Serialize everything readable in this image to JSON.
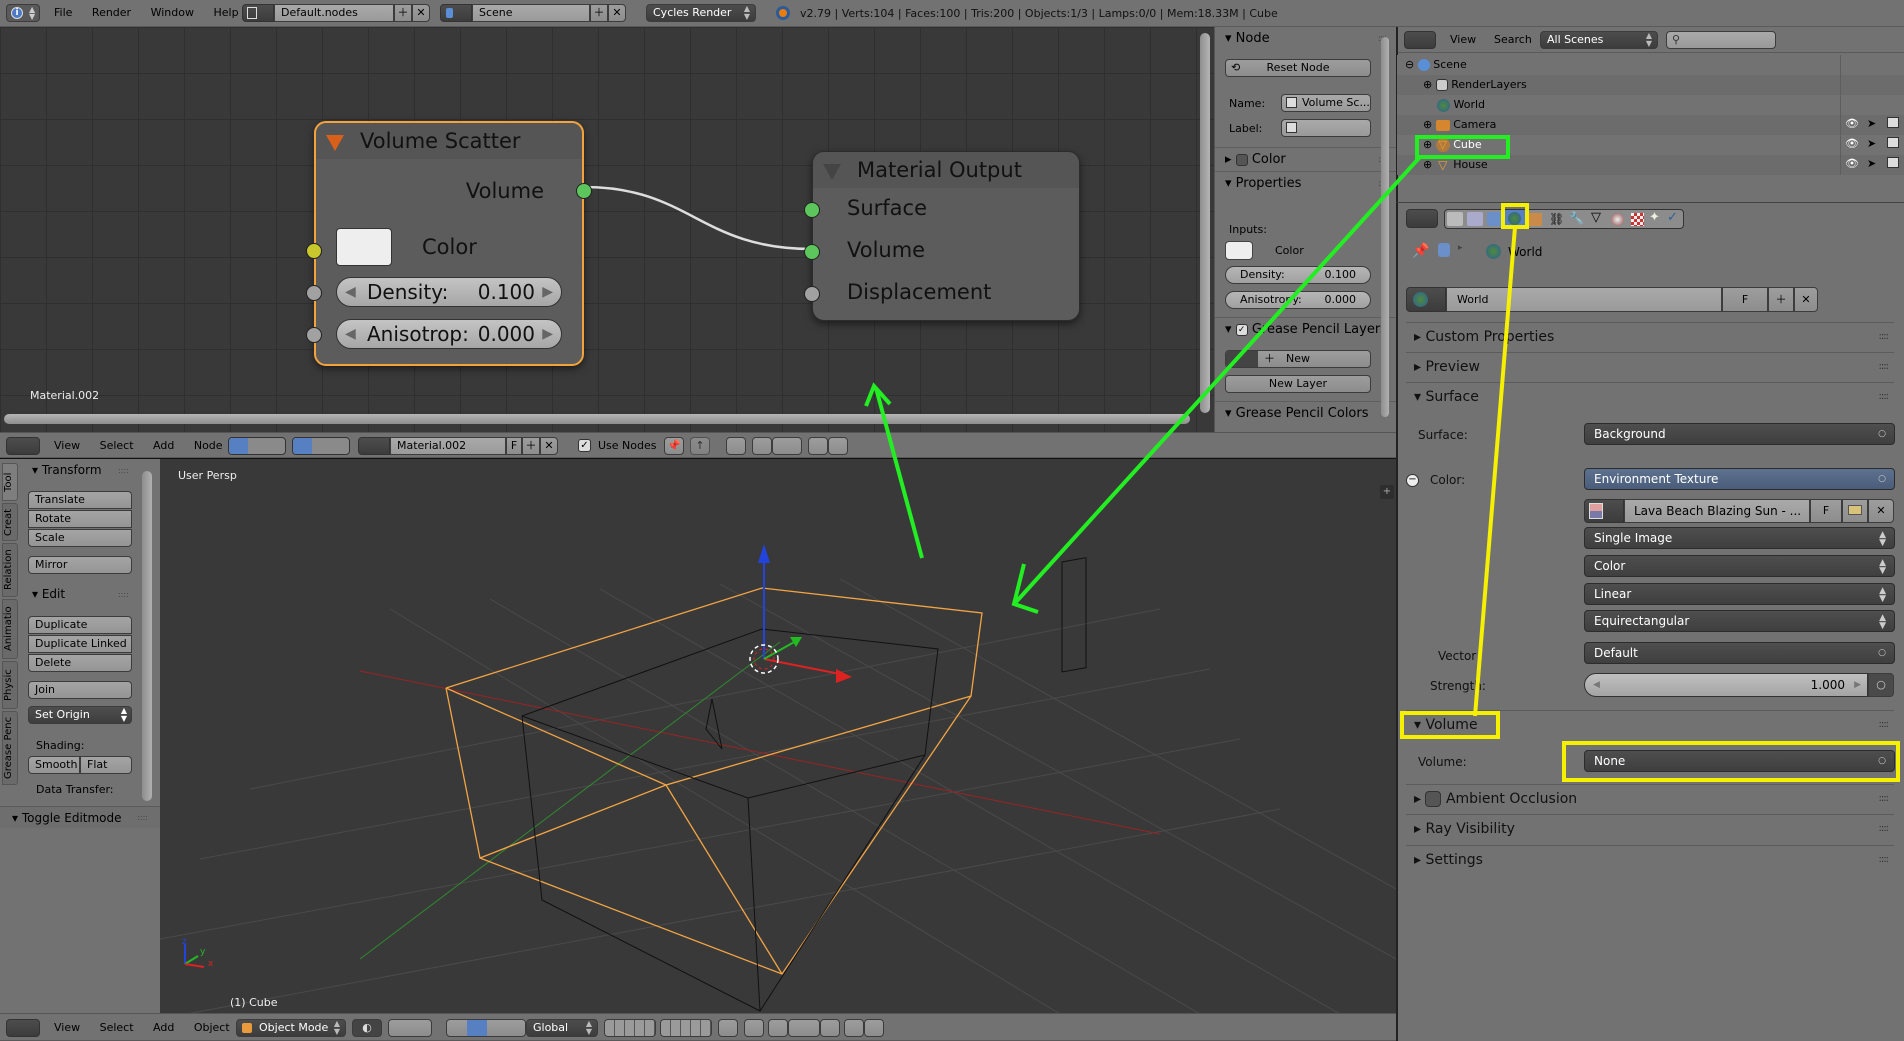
{
  "topbar": {
    "menus": [
      "File",
      "Render",
      "Window",
      "Help"
    ],
    "screen_layout": "Default.nodes",
    "scene": "Scene",
    "render_engine": "Cycles Render",
    "stats": "v2.79 | Verts:104 | Faces:100 | Tris:200 | Objects:1/3 | Lamps:0/0 | Mem:18.33M | Cube"
  },
  "node_editor": {
    "material_label": "Material.002",
    "nodes": {
      "volume_scatter": {
        "title": "Volume Scatter",
        "output": "Volume",
        "color_label": "Color",
        "density_label": "Density:",
        "density_value": "0.100",
        "anisotropy_label": "Anisotrop:",
        "anisotropy_value": "0.000"
      },
      "material_output": {
        "title": "Material Output",
        "inputs": [
          "Surface",
          "Volume",
          "Displacement"
        ]
      }
    },
    "header": {
      "menus": [
        "View",
        "Select",
        "Add",
        "Node"
      ],
      "material": "Material.002",
      "fake_user": "F",
      "use_nodes_label": "Use Nodes",
      "use_nodes": true
    },
    "sidebar": {
      "node_panel": "Node",
      "reset_node": "Reset Node",
      "name_label": "Name:",
      "name_value": "Volume Sc...",
      "label_label": "Label:",
      "label_value": "",
      "color_panel": "Color",
      "properties_panel": "Properties",
      "inputs_label": "Inputs:",
      "color_label": "Color",
      "density_label": "Density:",
      "density_value": "0.100",
      "anisotropy_label": "Anisotropy:",
      "anisotropy_value": "0.000",
      "grease_layers_panel": "Grease Pencil Layers",
      "new_button": "New",
      "new_layer_button": "New Layer",
      "grease_colors_panel": "Grease Pencil Colors"
    }
  },
  "viewport": {
    "view_name": "User Persp",
    "object_label": "(1) Cube",
    "tool_tabs": [
      "Tool",
      "Creat",
      "Relation",
      "Animatio",
      "Physic",
      "Grease Penc"
    ],
    "transform_panel": "Transform",
    "transform_buttons": [
      "Translate",
      "Rotate",
      "Scale"
    ],
    "mirror": "Mirror",
    "edit_panel": "Edit",
    "edit_buttons": [
      "Duplicate",
      "Duplicate Linked",
      "Delete"
    ],
    "join": "Join",
    "set_origin": "Set Origin",
    "shading_label": "Shading:",
    "smooth": "Smooth",
    "flat": "Flat",
    "data_transfer_label": "Data Transfer:",
    "toggle_editmode": "Toggle Editmode",
    "axis_labels": [
      "x",
      "y",
      "z"
    ],
    "header": {
      "menus": [
        "View",
        "Select",
        "Add",
        "Object"
      ],
      "mode": "Object Mode",
      "orientation": "Global"
    }
  },
  "outliner": {
    "menus": [
      "View",
      "Search"
    ],
    "filter": "All Scenes",
    "search_placeholder": "",
    "items": [
      {
        "name": "Scene",
        "level": 0
      },
      {
        "name": "RenderLayers",
        "level": 1
      },
      {
        "name": "World",
        "level": 1
      },
      {
        "name": "Camera",
        "level": 1
      },
      {
        "name": "Cube",
        "level": 1,
        "highlighted": true
      },
      {
        "name": "House",
        "level": 1
      }
    ]
  },
  "properties": {
    "breadcrumb": "World",
    "world_name": "World",
    "fake_user": "F",
    "panels": {
      "custom_properties": "Custom Properties",
      "preview": "Preview",
      "surface": "Surface",
      "volume": "Volume",
      "ambient_occlusion": "Ambient Occlusion",
      "ray_visibility": "Ray Visibility",
      "settings": "Settings"
    },
    "surface": {
      "surface_label": "Surface:",
      "surface_value": "Background",
      "color_label": "Color:",
      "color_value": "Environment Texture",
      "image": "Lava Beach Blazing Sun  - ...",
      "image_fake": "F",
      "source": "Single Image",
      "color_space": "Color",
      "interpolation": "Linear",
      "projection": "Equirectangular",
      "vector_label": "Vector",
      "vector_value": "Default",
      "strength_label": "Strength:",
      "strength_value": "1.000"
    },
    "volume": {
      "volume_label": "Volume:",
      "volume_value": "None"
    }
  },
  "annotations": {
    "green": "#22ee22",
    "yellow": "#f5f000"
  }
}
